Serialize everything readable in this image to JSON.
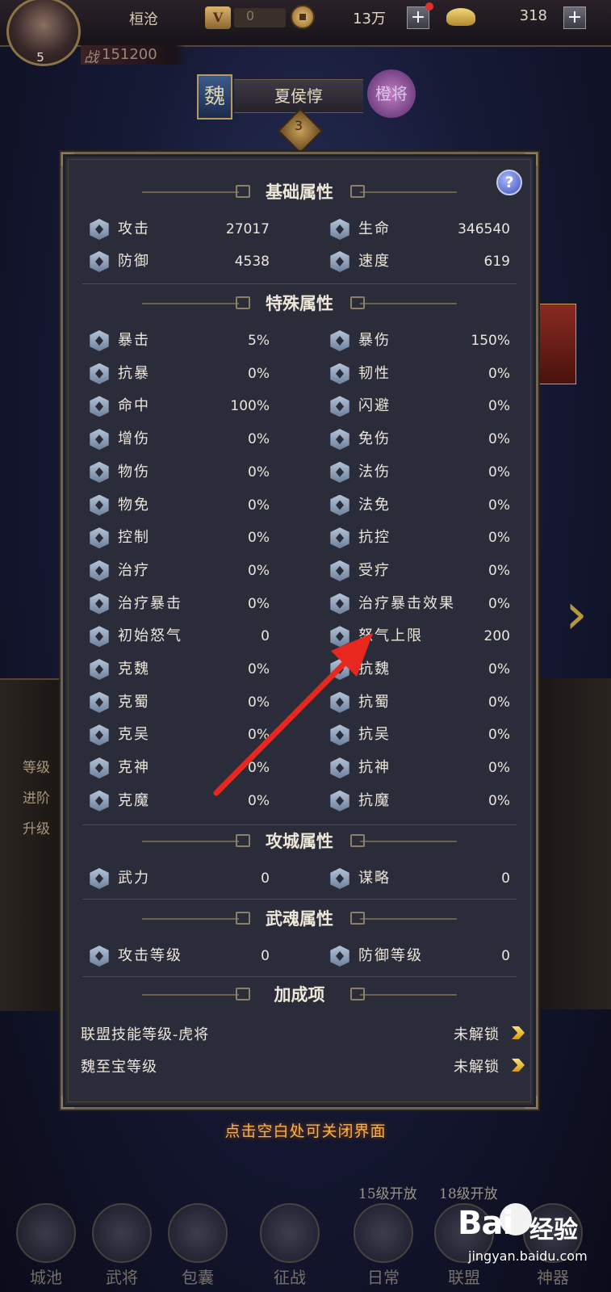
{
  "hud": {
    "player_name": "桓沧",
    "avatar_level": "5",
    "vip_badge": "V",
    "vip_level": "0",
    "coins": "13万",
    "ingots": "318",
    "power_label": "战",
    "power": "151200",
    "plus_label": "+"
  },
  "hero": {
    "kingdom": "魏",
    "name": "夏侯惇",
    "star_level": "3",
    "rank_label": "橙将"
  },
  "background_labels": {
    "left": [
      "等级",
      "进阶",
      "升级"
    ],
    "arrow": "›"
  },
  "panel": {
    "help_label": "?",
    "sections": {
      "basic": "基础属性",
      "special": "特殊属性",
      "siege": "攻城属性",
      "soul": "武魂属性",
      "bonus": "加成项"
    },
    "basic_stats": [
      {
        "icon": "sword-icon",
        "label": "攻击",
        "value": "27017"
      },
      {
        "icon": "heart-icon",
        "label": "生命",
        "value": "346540"
      },
      {
        "icon": "shield-icon",
        "label": "防御",
        "value": "4538"
      },
      {
        "icon": "speed-icon",
        "label": "速度",
        "value": "619"
      }
    ],
    "special_stats": [
      {
        "icon": "crit-icon",
        "label": "暴击",
        "value": "5%"
      },
      {
        "icon": "crit-damage-icon",
        "label": "暴伤",
        "value": "150%"
      },
      {
        "icon": "anti-crit-icon",
        "label": "抗暴",
        "value": "0%"
      },
      {
        "icon": "toughness-icon",
        "label": "韧性",
        "value": "0%"
      },
      {
        "icon": "accuracy-icon",
        "label": "命中",
        "value": "100%"
      },
      {
        "icon": "dodge-icon",
        "label": "闪避",
        "value": "0%"
      },
      {
        "icon": "damage-boost-icon",
        "label": "增伤",
        "value": "0%"
      },
      {
        "icon": "damage-reduction-icon",
        "label": "免伤",
        "value": "0%"
      },
      {
        "icon": "physical-damage-icon",
        "label": "物伤",
        "value": "0%"
      },
      {
        "icon": "magic-damage-icon",
        "label": "法伤",
        "value": "0%"
      },
      {
        "icon": "physical-resist-icon",
        "label": "物免",
        "value": "0%"
      },
      {
        "icon": "magic-resist-icon",
        "label": "法免",
        "value": "0%"
      },
      {
        "icon": "control-icon",
        "label": "控制",
        "value": "0%"
      },
      {
        "icon": "control-resist-icon",
        "label": "抗控",
        "value": "0%"
      },
      {
        "icon": "heal-icon",
        "label": "治疗",
        "value": "0%"
      },
      {
        "icon": "healed-icon",
        "label": "受疗",
        "value": "0%"
      },
      {
        "icon": "heal-crit-icon",
        "label": "治疗暴击",
        "value": "0%"
      },
      {
        "icon": "heal-crit-effect-icon",
        "label": "治疗暴击效果",
        "value": "0%"
      },
      {
        "icon": "initial-rage-icon",
        "label": "初始怒气",
        "value": "0"
      },
      {
        "icon": "rage-cap-icon",
        "label": "怒气上限",
        "value": "200"
      },
      {
        "icon": "vs-wei-icon",
        "label": "克魏",
        "value": "0%"
      },
      {
        "icon": "resist-wei-icon",
        "label": "抗魏",
        "value": "0%"
      },
      {
        "icon": "vs-shu-icon",
        "label": "克蜀",
        "value": "0%"
      },
      {
        "icon": "resist-shu-icon",
        "label": "抗蜀",
        "value": "0%"
      },
      {
        "icon": "vs-wu-icon",
        "label": "克吴",
        "value": "0%"
      },
      {
        "icon": "resist-wu-icon",
        "label": "抗吴",
        "value": "0%"
      },
      {
        "icon": "vs-god-icon",
        "label": "克神",
        "value": "0%"
      },
      {
        "icon": "resist-god-icon",
        "label": "抗神",
        "value": "0%"
      },
      {
        "icon": "vs-demon-icon",
        "label": "克魔",
        "value": "0%"
      },
      {
        "icon": "resist-demon-icon",
        "label": "抗魔",
        "value": "0%"
      }
    ],
    "siege_stats": [
      {
        "icon": "might-icon",
        "label": "武力",
        "value": "0"
      },
      {
        "icon": "strategy-icon",
        "label": "谋略",
        "value": "0"
      }
    ],
    "soul_stats": [
      {
        "icon": "sword-icon",
        "label": "攻击等级",
        "value": "0"
      },
      {
        "icon": "shield-icon",
        "label": "防御等级",
        "value": "0"
      }
    ],
    "bonus_items": [
      {
        "label": "联盟技能等级-虎将",
        "status": "未解锁"
      },
      {
        "label": "魏至宝等级",
        "status": "未解锁"
      }
    ]
  },
  "close_hint": "点击空白处可关闭界面",
  "bottom_nav": {
    "locked_notes": [
      "15级开放",
      "18级开放"
    ],
    "items": [
      {
        "label": "城池"
      },
      {
        "label": "武将"
      },
      {
        "label": "包囊"
      },
      {
        "label": "征战"
      },
      {
        "label": "日常"
      },
      {
        "label": "联盟"
      },
      {
        "label": "神器"
      }
    ]
  },
  "watermark": {
    "logo": "Bai",
    "logo_suffix": "经验",
    "url": "jingyan.baidu.com"
  }
}
